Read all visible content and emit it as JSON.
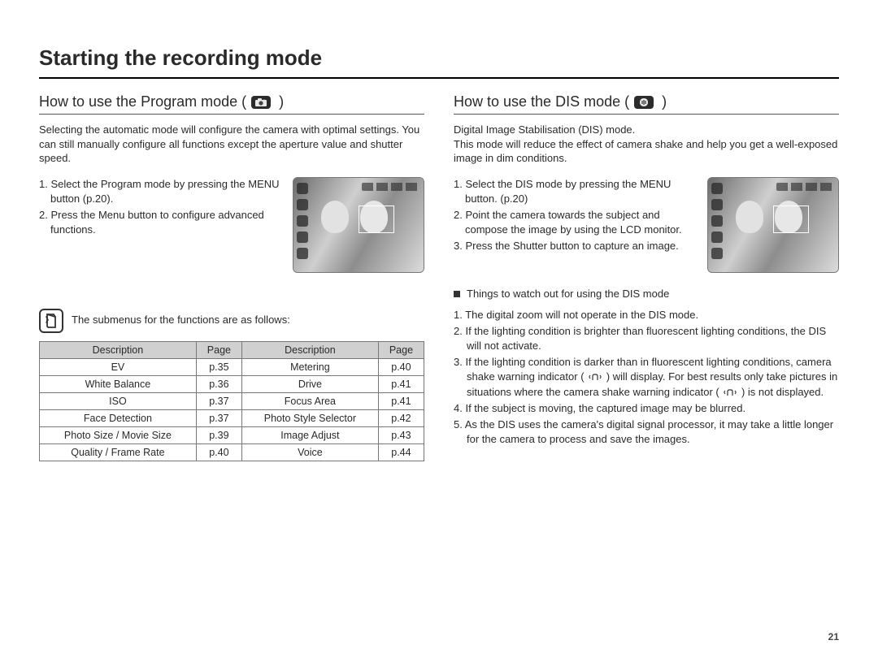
{
  "page_title": "Starting the recording mode",
  "page_number": "21",
  "left": {
    "heading_before": "How to use the Program mode (",
    "heading_after": ")",
    "intro": "Selecting the automatic mode will configure the camera with optimal settings. You can still manually configure all functions except the aperture value and shutter speed.",
    "steps": [
      "1. Select the Program mode by pressing the MENU button (p.20).",
      "2. Press the Menu button to configure advanced functions."
    ],
    "note": "The submenus for the functions are as follows:",
    "table": {
      "headers": [
        "Description",
        "Page",
        "Description",
        "Page"
      ],
      "rows": [
        [
          "EV",
          "p.35",
          "Metering",
          "p.40"
        ],
        [
          "White Balance",
          "p.36",
          "Drive",
          "p.41"
        ],
        [
          "ISO",
          "p.37",
          "Focus Area",
          "p.41"
        ],
        [
          "Face Detection",
          "p.37",
          "Photo Style Selector",
          "p.42"
        ],
        [
          "Photo Size / Movie Size",
          "p.39",
          "Image Adjust",
          "p.43"
        ],
        [
          "Quality / Frame Rate",
          "p.40",
          "Voice",
          "p.44"
        ]
      ]
    }
  },
  "right": {
    "heading_before": "How to use the DIS mode (",
    "heading_after": ")",
    "intro": "Digital Image Stabilisation (DIS) mode.\nThis mode will reduce the effect of camera shake and help you get a well-exposed image in dim conditions.",
    "steps": [
      "1. Select the DIS mode by pressing the MENU button. (p.20)",
      "2. Point the camera towards the subject and compose the image by using the LCD monitor.",
      "3. Press the Shutter button to capture an image."
    ],
    "watch_title": "Things to watch out for using the DIS mode",
    "watch_items": {
      "i1": "1. The digital zoom will not operate in the DIS mode.",
      "i2a": "2. If the lighting condition is brighter than fluorescent lighting conditions, the DIS will not activate.",
      "i3a": "3. If the lighting condition is darker than in fluorescent lighting conditions, camera shake warning indicator (",
      "i3b": ") will display. For best results only take pictures in situations where the camera shake warning indicator (",
      "i3c": ") is not displayed.",
      "i4": "4. If the subject is moving, the captured image may be blurred.",
      "i5": "5. As the DIS uses the camera's digital signal processor, it may take a little longer for the camera to process and save the images."
    }
  }
}
